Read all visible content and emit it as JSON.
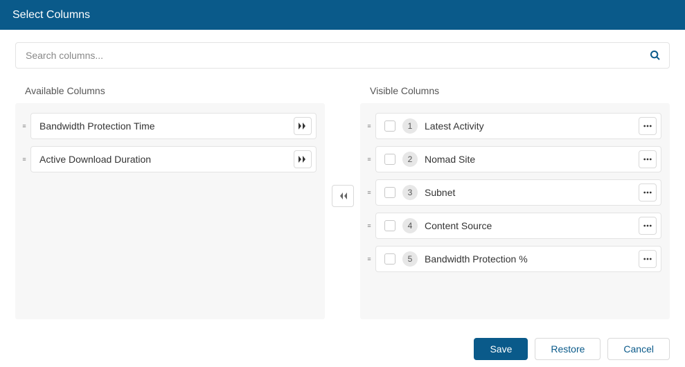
{
  "header": {
    "title": "Select Columns"
  },
  "search": {
    "placeholder": "Search columns...",
    "value": ""
  },
  "available": {
    "title": "Available Columns",
    "items": [
      {
        "label": "Bandwidth Protection Time"
      },
      {
        "label": "Active Download Duration"
      }
    ]
  },
  "visible": {
    "title": "Visible Columns",
    "items": [
      {
        "num": "1",
        "label": "Latest Activity"
      },
      {
        "num": "2",
        "label": "Nomad Site"
      },
      {
        "num": "3",
        "label": "Subnet"
      },
      {
        "num": "4",
        "label": "Content Source"
      },
      {
        "num": "5",
        "label": "Bandwidth Protection %"
      }
    ]
  },
  "buttons": {
    "save": "Save",
    "restore": "Restore",
    "cancel": "Cancel"
  }
}
